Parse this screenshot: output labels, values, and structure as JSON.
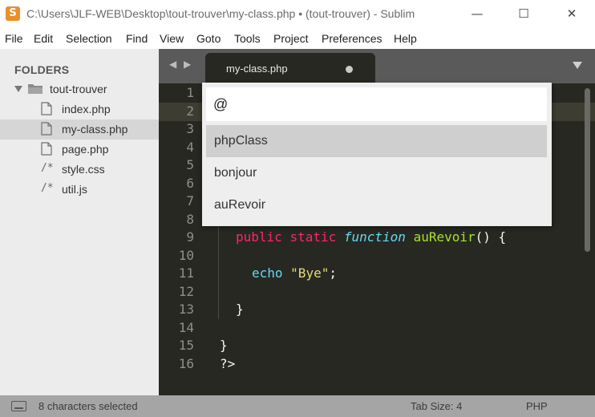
{
  "window": {
    "app_icon": "S",
    "title": "C:\\Users\\JLF-WEB\\Desktop\\tout-trouver\\my-class.php • (tout-trouver) - Sublim",
    "minimize": "—",
    "maximize": "☐",
    "close": "✕"
  },
  "menu": [
    "File",
    "Edit",
    "Selection",
    "Find",
    "View",
    "Goto",
    "Tools",
    "Project",
    "Preferences",
    "Help"
  ],
  "sidebar": {
    "title": "FOLDERS",
    "folder": "tout-trouver",
    "files": [
      {
        "name": "index.php",
        "icon": "file-icon"
      },
      {
        "name": "my-class.php",
        "icon": "file-icon",
        "selected": true
      },
      {
        "name": "page.php",
        "icon": "file-icon"
      },
      {
        "name": "style.css",
        "icon": "code-comment-icon",
        "glyph": "/*"
      },
      {
        "name": "util.js",
        "icon": "code-comment-icon",
        "glyph": "/*"
      }
    ]
  },
  "tabs": {
    "nav_prev": "◀",
    "nav_next": "▶",
    "active": "my-class.php"
  },
  "editor": {
    "line_numbers": [
      "1",
      "2",
      "3",
      "4",
      "5",
      "6",
      "7",
      "8",
      "9",
      "10",
      "11",
      "12",
      "13",
      "14",
      "15",
      "16"
    ],
    "visible_code": {
      "line9": {
        "kw1": "public",
        "kw2": "static",
        "fn": "function",
        "name": "auRevoir",
        "rest": "() {"
      },
      "line11": {
        "builtin": "echo",
        "str": "\"Bye\"",
        "rest": ";"
      },
      "line13": "}",
      "line15": "}",
      "line16": "?>"
    },
    "colors": {
      "background": "#272822",
      "keyword": "#f92672",
      "function": "#66d9ef",
      "name": "#a6e22e",
      "string": "#e6db74"
    }
  },
  "goto_symbol": {
    "input_value": "@",
    "items": [
      "phpClass",
      "bonjour",
      "auRevoir"
    ],
    "selected": "phpClass"
  },
  "status": {
    "selection": "8 characters selected",
    "tab_size": "Tab Size: 4",
    "syntax": "PHP"
  }
}
